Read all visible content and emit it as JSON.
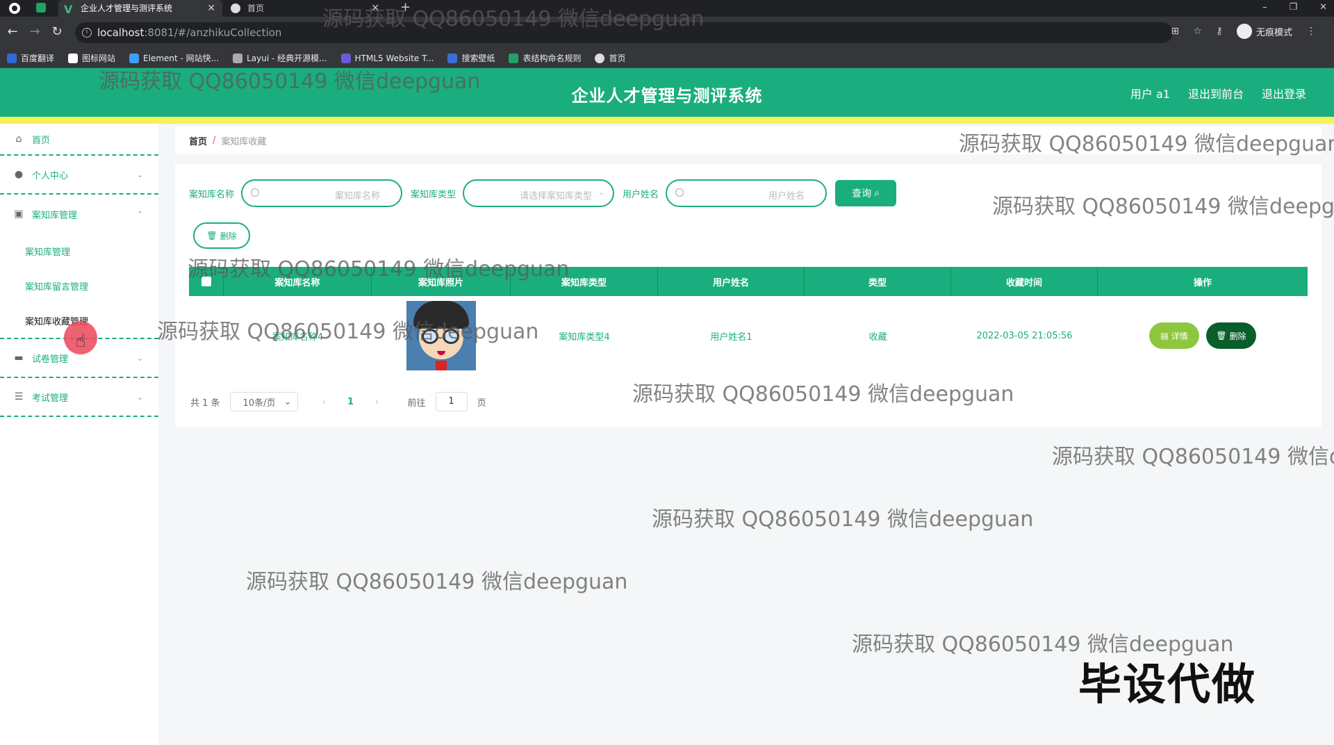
{
  "browser": {
    "active_tab_title": "企业人才管理与测评系统",
    "second_tab_title": "首页",
    "url_host": "localhost",
    "url_rest": ":8081/#/anzhikuCollection",
    "incognito_label": "无痕模式",
    "bookmarks": [
      {
        "label": "百度翻译",
        "color": "#2f6bd6"
      },
      {
        "label": "图标网站",
        "color": "#ffffff"
      },
      {
        "label": "Element - 网站快...",
        "color": "#409eff"
      },
      {
        "label": "Layui - 经典开源模...",
        "color": "#aaaaaa"
      },
      {
        "label": "HTML5 Website T...",
        "color": "#6b5bd6"
      },
      {
        "label": "搜索壁纸",
        "color": "#3b6fd6"
      },
      {
        "label": "表结构命名规则",
        "color": "#21a366"
      },
      {
        "label": "首页",
        "color": "#dddddd"
      }
    ]
  },
  "header": {
    "title": "企业人才管理与测评系统",
    "user": "用户 a1",
    "back_to_front": "退出到前台",
    "logout": "退出登录"
  },
  "sidebar": {
    "home": "首页",
    "personal": "个人中心",
    "kb_manage": "案知库管理",
    "sub_items": [
      "案知库管理",
      "案知库留言管理",
      "案知库收藏管理"
    ],
    "paper_manage": "试卷管理",
    "exam_manage": "考试管理"
  },
  "breadcrumb": {
    "home": "首页",
    "separator": "/",
    "current": "案知库收藏"
  },
  "search": {
    "name_label": "案知库名称",
    "name_placeholder": "案知库名称",
    "type_label": "案知库类型",
    "type_placeholder": "请选择案知库类型",
    "user_label": "用户姓名",
    "user_placeholder": "用户姓名",
    "query_button": "查询"
  },
  "toolbar": {
    "batch_delete": "删除"
  },
  "table": {
    "headers": [
      "案知库名称",
      "案知库照片",
      "案知库类型",
      "用户姓名",
      "类型",
      "收藏时间",
      "操作"
    ],
    "rows": [
      {
        "name": "案知库名称4",
        "type": "案知库类型4",
        "user": "用户姓名1",
        "kind": "收藏",
        "time": "2022-03-05 21:05:56",
        "detail_label": "详情",
        "delete_label": "删除"
      }
    ]
  },
  "pagination": {
    "total": "共 1 条",
    "page_size": "10条/页",
    "current_page": "1",
    "goto_label": "前往",
    "goto_value": "1",
    "page_unit": "页"
  },
  "watermarks": {
    "text": "源码获取 QQ86050149 微信deepguan",
    "clipped_1": "源码获取 QQ86050149 微信deepgu",
    "clipped_2": "源码获取 QQ86050149 微信d",
    "big": "毕设代做"
  },
  "colors": {
    "accent": "#1aae7e",
    "yellow_strip": "#f5f25a",
    "detail_button": "#8dc73f",
    "delete_button": "#0a5e2a"
  }
}
